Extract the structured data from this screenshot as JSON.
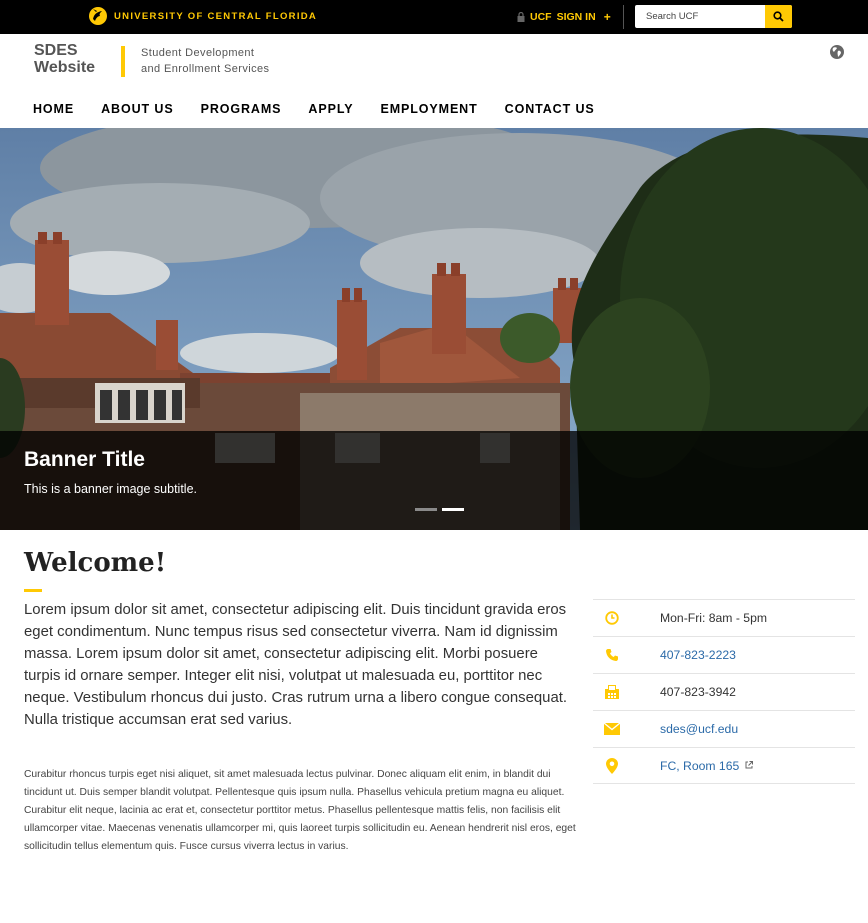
{
  "topbar": {
    "brand": "UNIVERSITY OF CENTRAL FLORIDA",
    "signin_prefix": "UCF",
    "signin_label": "SIGN IN",
    "signin_plus": "+",
    "search_placeholder": "Search UCF",
    "accent_color": "#ffc904"
  },
  "header": {
    "title_line1": "SDES",
    "title_line2": "Website",
    "subtitle_line1": "Student Development",
    "subtitle_line2": "and Enrollment Services"
  },
  "nav": {
    "items": [
      "HOME",
      "ABOUT US",
      "PROGRAMS",
      "APPLY",
      "EMPLOYMENT",
      "CONTACT US"
    ]
  },
  "banner": {
    "title": "Banner Title",
    "subtitle": "This is a banner image subtitle.",
    "slide_count": 2,
    "active_slide": 2
  },
  "main": {
    "heading": "Welcome!",
    "lead": "Lorem ipsum dolor sit amet, consectetur adipiscing elit. Duis tincidunt gravida eros eget condimentum. Nunc tempus risus sed consectetur viverra. Nam id dignissim massa. Lorem ipsum dolor sit amet, consectetur adipiscing elit. Morbi posuere turpis id ornare semper. Integer elit nisi, volutpat ut malesuada eu, porttitor nec neque. Vestibulum rhoncus dui justo. Cras rutrum urna a libero congue consequat. Nulla tristique accumsan erat sed varius.",
    "body": "Curabitur rhoncus turpis eget nisi aliquet, sit amet malesuada lectus pulvinar. Donec aliquam elit enim, in blandit dui tincidunt ut. Duis semper blandit volutpat. Pellentesque quis ipsum nulla. Phasellus vehicula pretium magna eu aliquet. Curabitur elit neque, lacinia ac erat et, consectetur porttitor metus. Phasellus pellentesque mattis felis, non facilisis elit ullamcorper vitae. Maecenas venenatis ullamcorper mi, quis laoreet turpis sollicitudin eu. Aenean hendrerit nisl eros, eget sollicitudin tellus elementum quis. Fusce cursus viverra lectus in varius."
  },
  "contact": {
    "hours": "Mon-Fri: 8am - 5pm",
    "phone": "407-823-2223",
    "fax": "407-823-3942",
    "email": "sdes@ucf.edu",
    "location": "FC, Room 165",
    "icons": [
      "clock-icon",
      "phone-icon",
      "fax-icon",
      "envelope-icon",
      "map-marker-icon"
    ]
  }
}
